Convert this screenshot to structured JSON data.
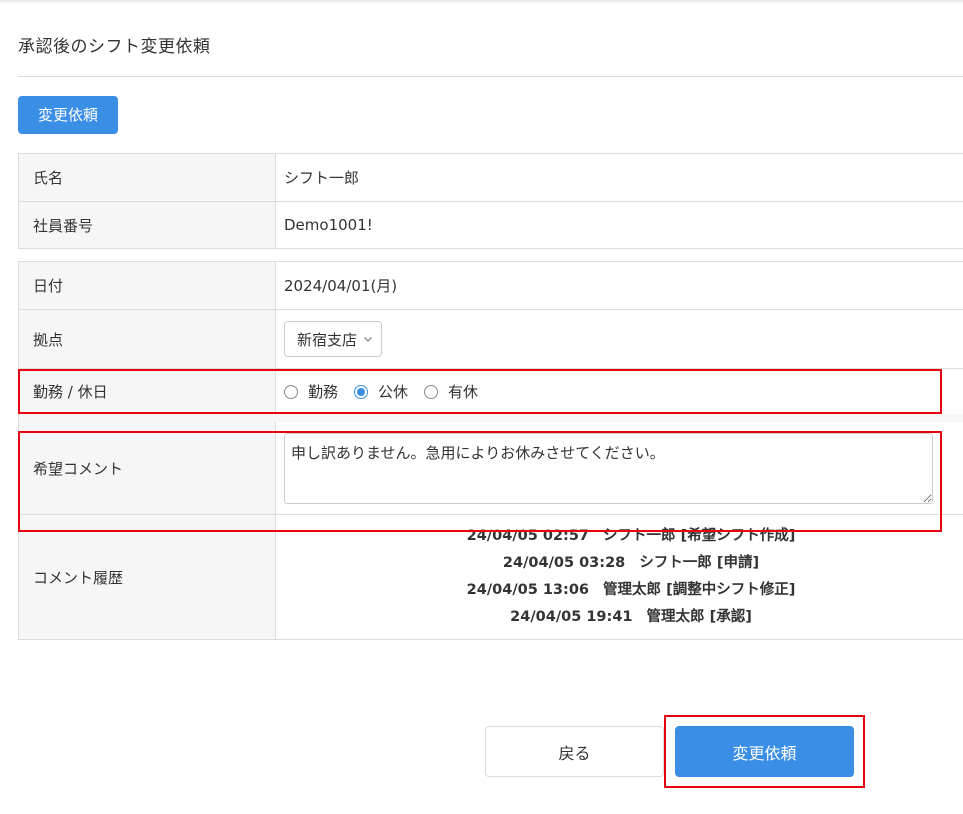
{
  "page": {
    "title": "承認後のシフト変更依頼",
    "top_button_label": "変更依頼"
  },
  "employee": {
    "name_label": "氏名",
    "name_value": "シフト一郎",
    "id_label": "社員番号",
    "id_value": "Demo1001!"
  },
  "shift": {
    "date_label": "日付",
    "date_value": "2024/04/01(月)",
    "location_label": "拠点",
    "location_selected": "新宿支店",
    "worktype_label": "勤務 / 休日",
    "worktype_options": [
      {
        "label": "勤務",
        "checked": false
      },
      {
        "label": "公休",
        "checked": true
      },
      {
        "label": "有休",
        "checked": false
      }
    ],
    "comment_label": "希望コメント",
    "comment_value": "申し訳ありません。急用によりお休みさせてください。",
    "history_label": "コメント履歴",
    "history": [
      {
        "timestamp": "24/04/05 02:57",
        "text": "シフト一郎 [希望シフト作成]"
      },
      {
        "timestamp": "24/04/05 03:28",
        "text": "シフト一郎 [申請]"
      },
      {
        "timestamp": "24/04/05 13:06",
        "text": "管理太郎 [調整中シフト修正]"
      },
      {
        "timestamp": "24/04/05 19:41",
        "text": "管理太郎 [承認]"
      }
    ]
  },
  "footer": {
    "back_label": "戻る",
    "submit_label": "変更依頼"
  },
  "colors": {
    "accent": "#3a8ee6",
    "highlight": "#e60012"
  },
  "icons": {
    "select_chevron": "chevron-down-icon"
  }
}
